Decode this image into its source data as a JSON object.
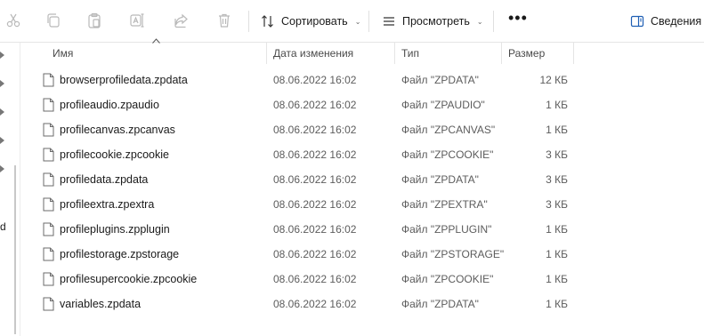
{
  "toolbar": {
    "icons": [
      "cut-icon",
      "copy-icon",
      "paste-icon",
      "rename-icon",
      "share-icon",
      "delete-icon"
    ],
    "sort_label": "Сортировать",
    "view_label": "Просмотреть",
    "more_label": "•••",
    "details_label": "Сведения"
  },
  "leftpane": {
    "partial_text": "d"
  },
  "columns": {
    "name": "Имя",
    "date": "Дата изменения",
    "type": "Тип",
    "size": "Размер"
  },
  "files": [
    {
      "name": "browserprofiledata.zpdata",
      "date": "08.06.2022 16:02",
      "type": "Файл \"ZPDATA\"",
      "size": "12 КБ"
    },
    {
      "name": "profileaudio.zpaudio",
      "date": "08.06.2022 16:02",
      "type": "Файл \"ZPAUDIO\"",
      "size": "1 КБ"
    },
    {
      "name": "profilecanvas.zpcanvas",
      "date": "08.06.2022 16:02",
      "type": "Файл \"ZPCANVAS\"",
      "size": "1 КБ"
    },
    {
      "name": "profilecookie.zpcookie",
      "date": "08.06.2022 16:02",
      "type": "Файл \"ZPCOOKIE\"",
      "size": "3 КБ"
    },
    {
      "name": "profiledata.zpdata",
      "date": "08.06.2022 16:02",
      "type": "Файл \"ZPDATA\"",
      "size": "3 КБ"
    },
    {
      "name": "profileextra.zpextra",
      "date": "08.06.2022 16:02",
      "type": "Файл \"ZPEXTRA\"",
      "size": "3 КБ"
    },
    {
      "name": "profileplugins.zpplugin",
      "date": "08.06.2022 16:02",
      "type": "Файл \"ZPPLUGIN\"",
      "size": "1 КБ"
    },
    {
      "name": "profilestorage.zpstorage",
      "date": "08.06.2022 16:02",
      "type": "Файл \"ZPSTORAGE\"",
      "size": "1 КБ"
    },
    {
      "name": "profilesupercookie.zpcookie",
      "date": "08.06.2022 16:02",
      "type": "Файл \"ZPCOOKIE\"",
      "size": "1 КБ"
    },
    {
      "name": "variables.zpdata",
      "date": "08.06.2022 16:02",
      "type": "Файл \"ZPDATA\"",
      "size": "1 КБ"
    }
  ]
}
